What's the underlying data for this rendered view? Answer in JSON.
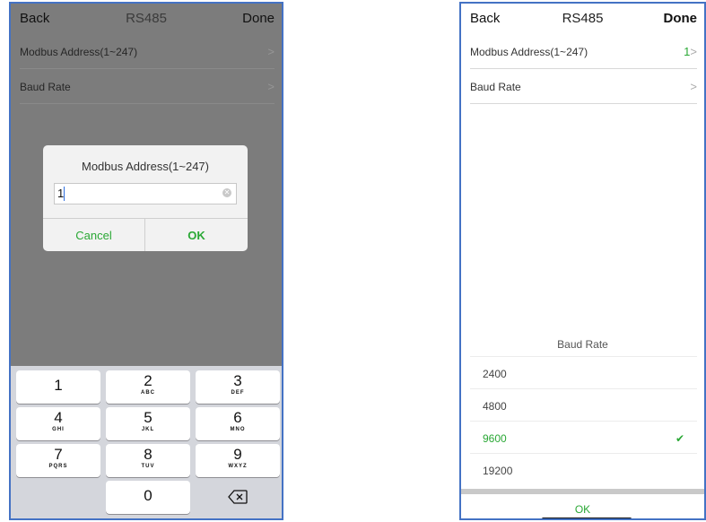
{
  "left": {
    "nav": {
      "back": "Back",
      "title": "RS485",
      "done": "Done"
    },
    "rows": [
      {
        "label": "Modbus Address(1~247)",
        "chevron": ">"
      },
      {
        "label": "Baud Rate",
        "chevron": ">"
      }
    ],
    "dialog": {
      "title": "Modbus Address(1~247)",
      "value": "1",
      "cancel": "Cancel",
      "ok": "OK"
    },
    "keypad": {
      "keys": [
        {
          "num": "1",
          "letters": ""
        },
        {
          "num": "2",
          "letters": "ABC"
        },
        {
          "num": "3",
          "letters": "DEF"
        },
        {
          "num": "4",
          "letters": "GHI"
        },
        {
          "num": "5",
          "letters": "JKL"
        },
        {
          "num": "6",
          "letters": "MNO"
        },
        {
          "num": "7",
          "letters": "PQRS"
        },
        {
          "num": "8",
          "letters": "TUV"
        },
        {
          "num": "9",
          "letters": "WXYZ"
        },
        {
          "num": "0",
          "letters": ""
        }
      ],
      "backspace_icon": "backspace-icon"
    }
  },
  "right": {
    "nav": {
      "back": "Back",
      "title": "RS485",
      "done": "Done"
    },
    "rows": [
      {
        "label": "Modbus Address(1~247)",
        "value": "1",
        "chevron": ">"
      },
      {
        "label": "Baud Rate",
        "chevron": ">"
      }
    ],
    "picker": {
      "title": "Baud Rate",
      "options": [
        "2400",
        "4800",
        "9600",
        "19200"
      ],
      "selected": "9600",
      "ok": "OK"
    }
  },
  "colors": {
    "accent": "#2aa835",
    "frame": "#4472c4",
    "dim": "#7c7c7c"
  }
}
